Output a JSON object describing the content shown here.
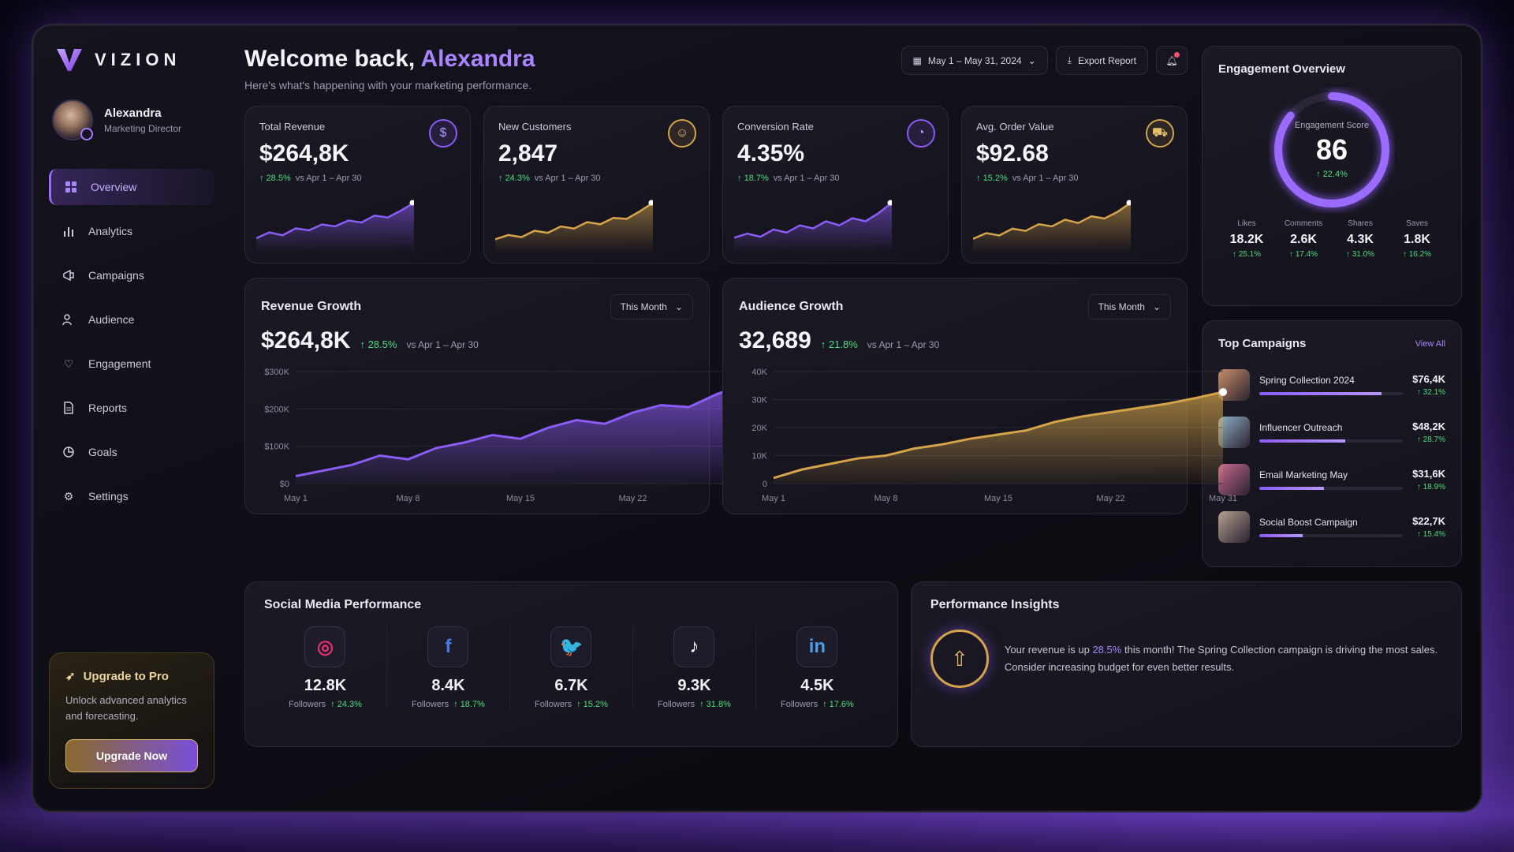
{
  "brand": {
    "name": "VIZION"
  },
  "user": {
    "name": "Alexandra",
    "role": "Marketing Director"
  },
  "nav": [
    {
      "label": "Overview",
      "icon": "grid-icon",
      "active": true
    },
    {
      "label": "Analytics",
      "icon": "bar-chart-icon"
    },
    {
      "label": "Campaigns",
      "icon": "megaphone-icon"
    },
    {
      "label": "Audience",
      "icon": "users-icon"
    },
    {
      "label": "Engagement",
      "icon": "heart-icon"
    },
    {
      "label": "Reports",
      "icon": "document-icon"
    },
    {
      "label": "Goals",
      "icon": "pie-icon"
    },
    {
      "label": "Settings",
      "icon": "gear-icon"
    }
  ],
  "upgrade": {
    "title": "Upgrade to Pro",
    "text": "Unlock advanced analytics and forecasting.",
    "button": "Upgrade Now"
  },
  "header": {
    "welcome": "Welcome back,",
    "name": "Alexandra",
    "subtitle": "Here's what's happening with your marketing performance.",
    "date_range": "May 1 – May 31, 2024",
    "export": "Export Report"
  },
  "kpis": [
    {
      "title": "Total Revenue",
      "value": "$264,8K",
      "delta": "28.5%",
      "vs": "vs Apr 1 – Apr 30",
      "icon": "dollar-icon",
      "color": "#8b5cf6",
      "spark": [
        12,
        18,
        15,
        22,
        20,
        26,
        24,
        30,
        28,
        35,
        33,
        40,
        48
      ]
    },
    {
      "title": "New Customers",
      "value": "2,847",
      "delta": "24.3%",
      "vs": "vs Apr 1 – Apr 30",
      "icon": "user-icon",
      "color": "#d4a44a",
      "spark": [
        10,
        14,
        12,
        18,
        16,
        22,
        20,
        26,
        24,
        30,
        29,
        36,
        44
      ]
    },
    {
      "title": "Conversion Rate",
      "value": "4.35%",
      "delta": "18.7%",
      "vs": "vs Apr 1 – Apr 30",
      "icon": "pie-chart-icon",
      "color": "#8b5cf6",
      "spark": [
        12,
        16,
        13,
        20,
        17,
        24,
        21,
        28,
        24,
        31,
        28,
        36,
        46
      ]
    },
    {
      "title": "Avg. Order Value",
      "value": "$92.68",
      "delta": "15.2%",
      "vs": "vs Apr 1 – Apr 30",
      "icon": "cart-icon",
      "color": "#d4a44a",
      "spark": [
        10,
        15,
        13,
        19,
        17,
        23,
        21,
        27,
        24,
        30,
        28,
        34,
        42
      ]
    }
  ],
  "revenue": {
    "title": "Revenue Growth",
    "select": "This Month",
    "value": "$264,8K",
    "delta": "28.5%",
    "vs": "vs Apr 1 – Apr 30"
  },
  "audience": {
    "title": "Audience Growth",
    "select": "This Month",
    "value": "32,689",
    "delta": "21.8%",
    "vs": "vs Apr 1 – Apr 30"
  },
  "chart_data": [
    {
      "type": "area",
      "x": [
        "May 1",
        "May 8",
        "May 15",
        "May 22",
        "May 31"
      ],
      "ytick_labels": [
        "$0",
        "$100K",
        "$200K",
        "$300K"
      ],
      "ylim": [
        0,
        300000
      ],
      "color": "#8b5cf6",
      "values": [
        20000,
        35000,
        50000,
        75000,
        65000,
        95000,
        110000,
        130000,
        120000,
        150000,
        170000,
        160000,
        190000,
        210000,
        205000,
        240000,
        264800
      ]
    },
    {
      "type": "area",
      "x": [
        "May 1",
        "May 8",
        "May 15",
        "May 22",
        "May 31"
      ],
      "ytick_labels": [
        "0",
        "10K",
        "20K",
        "30K",
        "40K"
      ],
      "ylim": [
        0,
        40000
      ],
      "color": "#d4a44a",
      "values": [
        2000,
        5000,
        7000,
        9000,
        10000,
        12500,
        14000,
        16000,
        17500,
        19000,
        22000,
        24000,
        25500,
        27000,
        28500,
        30500,
        32689
      ]
    }
  ],
  "social": {
    "title": "Social Media Performance",
    "followers_label": "Followers",
    "items": [
      {
        "platform": "instagram",
        "icon": "instagram-icon",
        "glyph": "◎",
        "color": "#e1306c",
        "count": "12.8K",
        "delta": "24.3%"
      },
      {
        "platform": "facebook",
        "icon": "facebook-icon",
        "glyph": "f",
        "color": "#4a78e0",
        "count": "8.4K",
        "delta": "18.7%"
      },
      {
        "platform": "twitter",
        "icon": "twitter-icon",
        "glyph": "🐦",
        "color": "#4aa8f0",
        "count": "6.7K",
        "delta": "15.2%"
      },
      {
        "platform": "tiktok",
        "icon": "tiktok-icon",
        "glyph": "♪",
        "color": "#ffffff",
        "count": "9.3K",
        "delta": "31.8%"
      },
      {
        "platform": "linkedin",
        "icon": "linkedin-icon",
        "glyph": "in",
        "color": "#4a9be8",
        "count": "4.5K",
        "delta": "17.6%"
      }
    ]
  },
  "insights": {
    "title": "Performance Insights",
    "text_pre": "Your revenue is up ",
    "highlight": "28.5%",
    "text_post": " this month! The Spring Collection campaign is driving the most sales. Consider increasing budget for even better results."
  },
  "engagement": {
    "title": "Engagement Overview",
    "score_label": "Engagement Score",
    "score": "86",
    "score_fraction": 0.86,
    "delta": "22.4%",
    "stats": [
      {
        "label": "Likes",
        "value": "18.2K",
        "delta": "25.1%"
      },
      {
        "label": "Comments",
        "value": "2.6K",
        "delta": "17.4%"
      },
      {
        "label": "Shares",
        "value": "4.3K",
        "delta": "31.0%"
      },
      {
        "label": "Saves",
        "value": "1.8K",
        "delta": "16.2%"
      }
    ]
  },
  "campaigns": {
    "title": "Top Campaigns",
    "view_all": "View All",
    "items": [
      {
        "name": "Spring Collection 2024",
        "amount": "$76,4K",
        "delta": "32.1%",
        "progress": 0.85,
        "thumb": "#c98f6b"
      },
      {
        "name": "Influencer Outreach",
        "amount": "$48,2K",
        "delta": "28.7%",
        "progress": 0.6,
        "thumb": "#8fb3c9"
      },
      {
        "name": "Email Marketing May",
        "amount": "$31,6K",
        "delta": "18.9%",
        "progress": 0.45,
        "thumb": "#c96b8f"
      },
      {
        "name": "Social Boost Campaign",
        "amount": "$22,7K",
        "delta": "15.4%",
        "progress": 0.3,
        "thumb": "#b3a08f"
      }
    ]
  }
}
